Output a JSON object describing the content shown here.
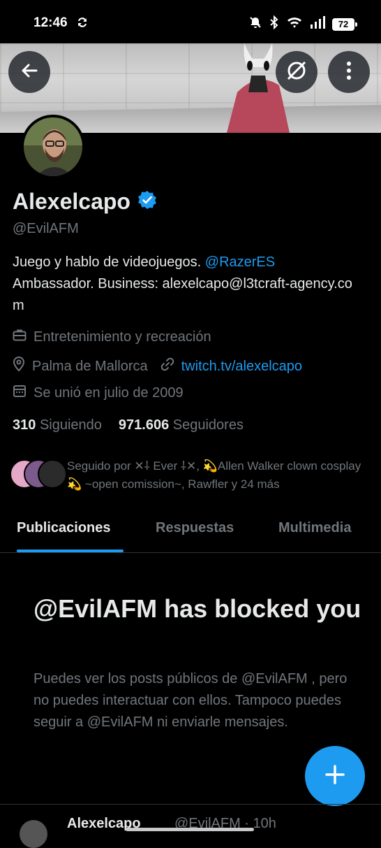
{
  "status_bar": {
    "time": "12:46",
    "battery": "72"
  },
  "banner": {
    "back_icon": "arrow-left-icon",
    "grok_icon": "grok-icon",
    "more_icon": "more-vertical-icon"
  },
  "profile": {
    "name": "Alexelcapo",
    "verified": true,
    "handle": "@EvilAFM",
    "bio_text": "Juego y hablo de videojuegos. ",
    "bio_mention": "@RazerES",
    "bio_rest": "Ambassador. Business: alexelcapo@l3tcraft-agency.com",
    "category": "Entretenimiento y recreación",
    "location": "Palma de Mallorca",
    "website": "twitch.tv/alexelcapo",
    "joined": "Se unió en julio de 2009",
    "following_count": "310",
    "following_label": "Siguiendo",
    "followers_count": "971.606",
    "followers_label": "Seguidores",
    "followed_by": "Seguido por ✕⸸ Ever ⸸✕, 💫Allen Walker clown cosplay💫 ~open comission~, Rawfler y 24 más"
  },
  "tabs": [
    {
      "label": "Publicaciones",
      "active": true
    },
    {
      "label": "Respuestas",
      "active": false
    },
    {
      "label": "Multimedia",
      "active": false
    }
  ],
  "blocked": {
    "title": "@EvilAFM has blocked you",
    "message": "Puedes ver los posts públicos de @EvilAFM , pero no puedes interactuar con ellos. Tampoco puedes seguir a @EvilAFM ni enviarle mensajes."
  },
  "bottom_peek": {
    "name": "Alexelcapo",
    "handle": "@EvilAFM · 10h"
  },
  "colors": {
    "accent": "#1d9bf0",
    "background": "#000000",
    "muted": "#71767b",
    "text": "#e7e9ea"
  }
}
